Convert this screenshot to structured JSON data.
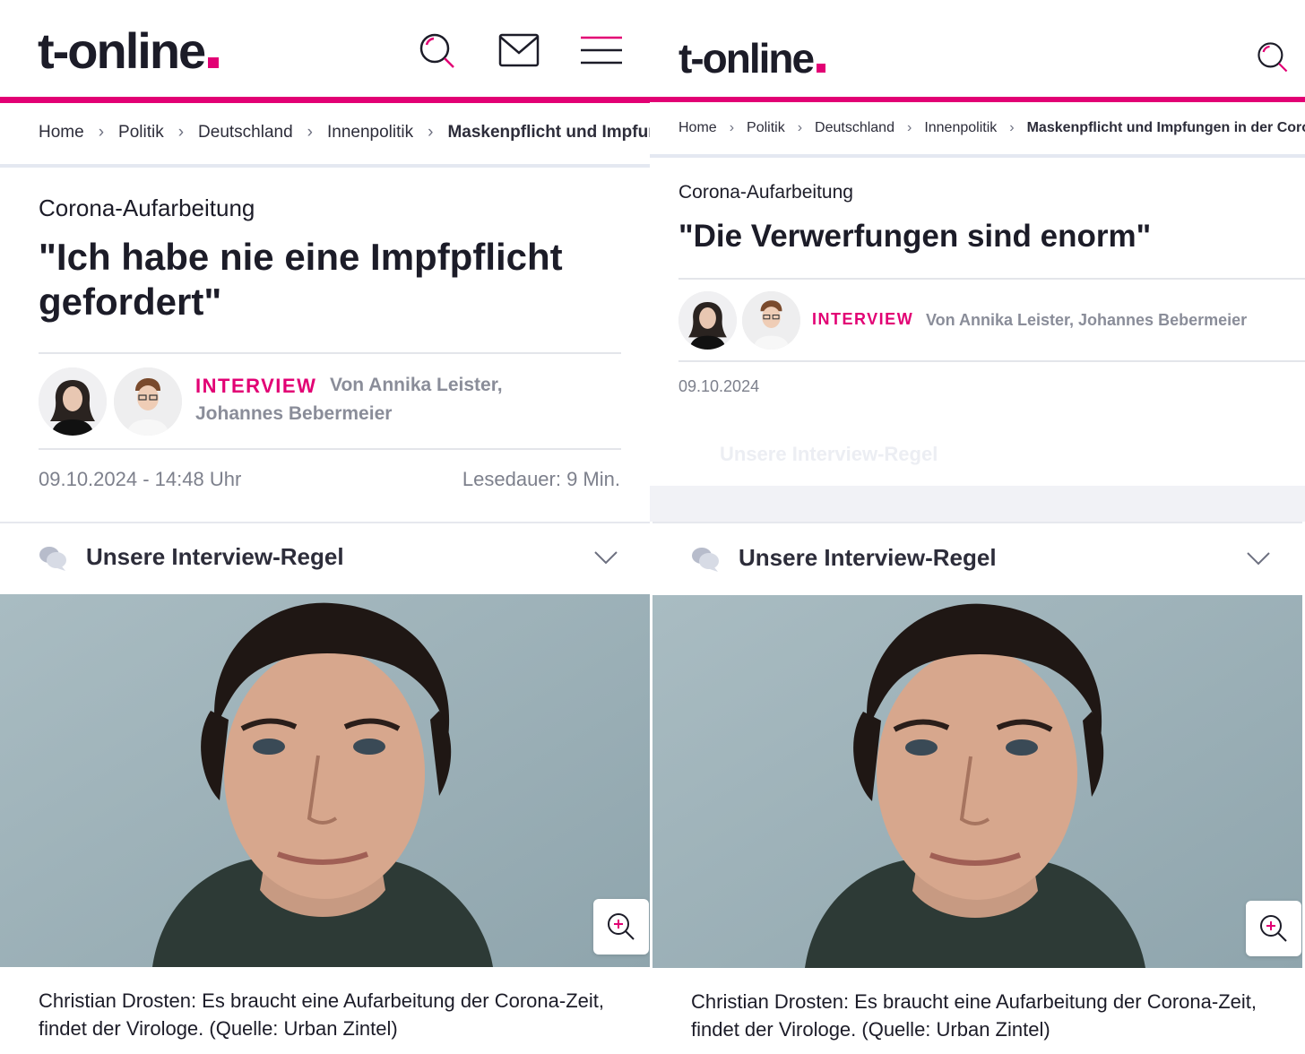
{
  "brand": {
    "logo": "t-online",
    "accent": "#e20074",
    "text_color": "#1c1c28"
  },
  "left": {
    "header_icons": [
      "search-icon",
      "mail-icon",
      "menu-icon"
    ],
    "breadcrumb": [
      "Home",
      "Politik",
      "Deutschland",
      "Innenpolitik",
      "Maskenpflicht und Impfungen in der Corona-Zeit"
    ],
    "kicker": "Corona-Aufarbeitung",
    "headline": "\"Ich habe nie eine Impfpflicht gefordert\"",
    "tag": "INTERVIEW",
    "authors": "Von Annika Leister, Johannes Bebermeier",
    "date": "09.10.2024 - 14:48 Uhr",
    "read_time": "Lesedauer: 9 Min.",
    "interview_rule": "Unsere Interview-Regel",
    "caption": "Christian Drosten: Es braucht eine Aufarbeitung der Corona-Zeit, findet der Virologe. (Quelle: Urban Zintel)"
  },
  "right": {
    "header_icons": [
      "search-icon"
    ],
    "breadcrumb": [
      "Home",
      "Politik",
      "Deutschland",
      "Innenpolitik",
      "Maskenpflicht und Impfungen in der Corona-Zeit"
    ],
    "kicker": "Corona-Aufarbeitung",
    "headline": "\"Die Verwerfungen sind enorm\"",
    "tag": "INTERVIEW",
    "authors": "Von Annika Leister, Johannes Bebermeier",
    "date": "09.10.2024",
    "faded_rule": "Unsere Interview-Regel",
    "interview_rule": "Unsere Interview-Regel",
    "caption": "Christian Drosten: Es braucht eine Aufarbeitung der Corona-Zeit, findet der Virologe. (Quelle: Urban Zintel)"
  }
}
